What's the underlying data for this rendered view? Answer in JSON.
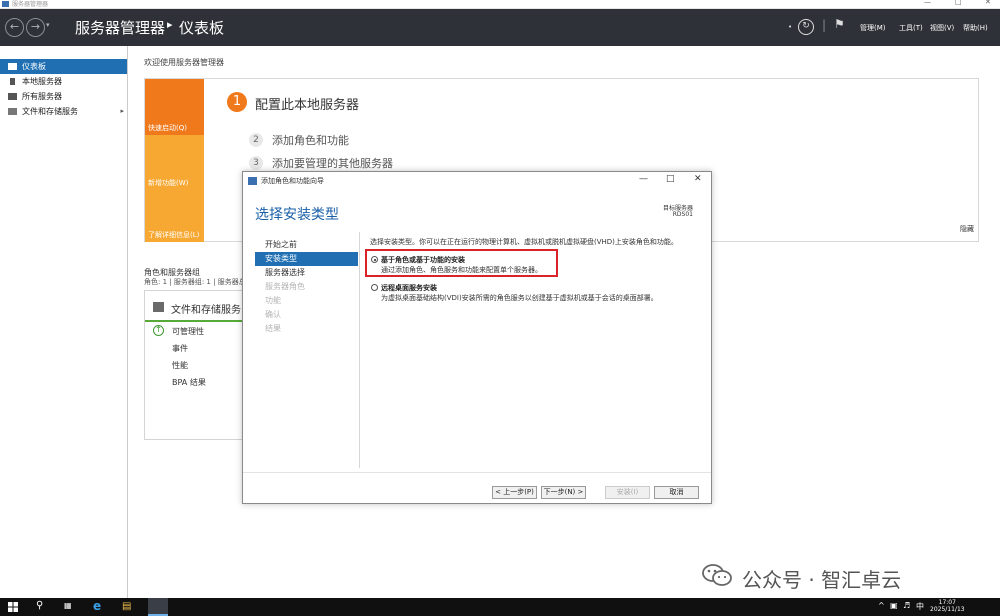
{
  "window": {
    "title": "服务器管理器",
    "controls": [
      "—",
      "□",
      "✕"
    ]
  },
  "header": {
    "breadcrumb_root": "服务器管理器",
    "breadcrumb_sep": "▸",
    "breadcrumb_current": "仪表板",
    "back_icon": "arrow-left-icon",
    "forward_icon": "arrow-right-icon",
    "menus": [
      "管理(M)",
      "工具(T)",
      "视图(V)",
      "帮助(H)"
    ]
  },
  "sidebar": {
    "items": [
      {
        "label": "仪表板",
        "icon": "dashboard-icon",
        "active": true
      },
      {
        "label": "本地服务器",
        "icon": "server-icon",
        "active": false
      },
      {
        "label": "所有服务器",
        "icon": "servers-icon",
        "active": false
      },
      {
        "label": "文件和存储服务",
        "icon": "storage-icon",
        "active": false,
        "arrow": "▸"
      }
    ]
  },
  "welcome": {
    "title": "欢迎使用服务器管理器",
    "blocks": [
      "快速启动(Q)",
      "新增功能(W)",
      "了解详细信息(L)"
    ],
    "steps": [
      {
        "num": "1",
        "text": "配置此本地服务器"
      },
      {
        "num": "2",
        "text": "添加角色和功能"
      },
      {
        "num": "3",
        "text": "添加要管理的其他服务器"
      }
    ],
    "hide_label": "隐藏"
  },
  "roles_group": {
    "title": "角色和服务器组",
    "subtitle": "角色: 1 | 服务器组: 1 | 服务器总数: 1",
    "tile": {
      "title": "文件和存储服务",
      "rows": [
        "可管理性",
        "事件",
        "性能",
        "BPA 结果"
      ]
    }
  },
  "wizard": {
    "title": "添加角色和功能向导",
    "heading": "选择安装类型",
    "destination_label": "目标服务器",
    "destination_server": "RDS01",
    "nav": [
      {
        "label": "开始之前",
        "state": "normal"
      },
      {
        "label": "安装类型",
        "state": "current"
      },
      {
        "label": "服务器选择",
        "state": "normal"
      },
      {
        "label": "服务器角色",
        "state": "disabled"
      },
      {
        "label": "功能",
        "state": "disabled"
      },
      {
        "label": "确认",
        "state": "disabled"
      },
      {
        "label": "结果",
        "state": "disabled"
      }
    ],
    "description": "选择安装类型。你可以在正在运行的物理计算机、虚拟机或脱机虚拟硬盘(VHD)上安装角色和功能。",
    "options": [
      {
        "title": "基于角色或基于功能的安装",
        "desc": "通过添加角色、角色服务和功能来配置单个服务器。",
        "selected": true
      },
      {
        "title": "远程桌面服务安装",
        "desc": "为虚拟桌面基础结构(VDI)安装所需的角色服务以创建基于虚拟机或基于会话的桌面部署。",
        "selected": false
      }
    ],
    "buttons": {
      "prev": "< 上一步(P)",
      "next": "下一步(N) >",
      "install": "安装(I)",
      "cancel": "取消"
    }
  },
  "watermark": {
    "text": "公众号 · 智汇卓云"
  },
  "taskbar": {
    "clock_time": "17:07",
    "clock_date": "2025/11/13",
    "ime": "中"
  },
  "colors": {
    "header_bg": "#2e3137",
    "accent_blue": "#1f6fb2",
    "quickstart_orange": "#f07a1b",
    "block_yellow": "#f6a832",
    "highlight_red": "#d9222a",
    "health_green": "#57a93a"
  }
}
